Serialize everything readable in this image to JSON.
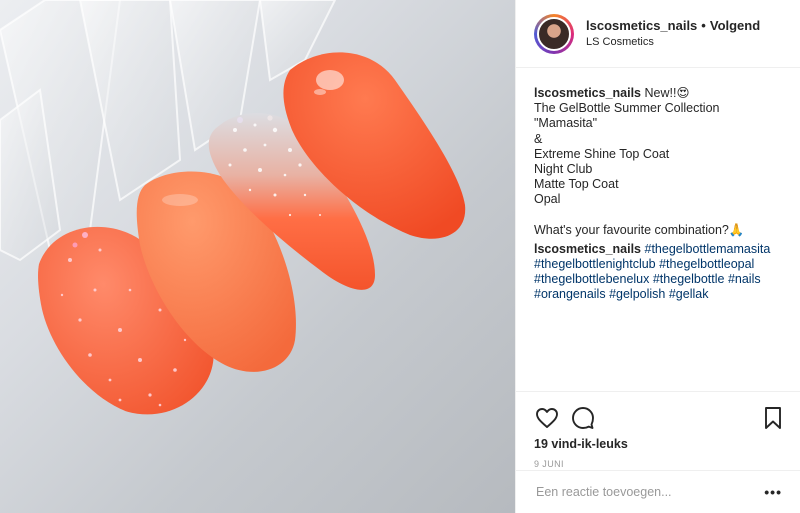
{
  "post": {
    "image_alt": "Four orange nail swatches on clear tips",
    "header": {
      "username": "lscosmetics_nails",
      "separator": "•",
      "follow_label": "Volgend",
      "location": "LS Cosmetics",
      "avatar_icon": "profile-avatar"
    },
    "caption": {
      "username": "lscosmetics_nails",
      "lines": [
        "New!!😍",
        "The GelBottle Summer Collection",
        "\"Mamasita\"",
        "&",
        "Extreme Shine Top Coat",
        "Night Club",
        "Matte Top Coat",
        "Opal"
      ],
      "question": "What's your favourite combination?🙏"
    },
    "comment": {
      "username": "lscosmetics_nails",
      "hashtags": [
        "#thegelbottlemamasita",
        "#thegelbottlenightclub",
        "#thegelbottleopal",
        "#thegelbottlebenelux",
        "#thegelbottle",
        "#nails",
        "#orangenails",
        "#gelpolish",
        "#gellak"
      ]
    },
    "actions": {
      "like_icon": "heart-icon",
      "comment_icon": "comment-bubble-icon",
      "save_icon": "bookmark-icon"
    },
    "likes_label": "19 vind-ik-leuks",
    "date_label": "9 JUNI",
    "comment_box": {
      "placeholder": "Een reactie toevoegen...",
      "more_label": "•••"
    },
    "colors": {
      "nail_coral": "#ff6a3d",
      "nail_peach": "#ff7a4f",
      "glitter_silver": "#d8d8dc",
      "background_grey": "#c8ccd1"
    }
  }
}
